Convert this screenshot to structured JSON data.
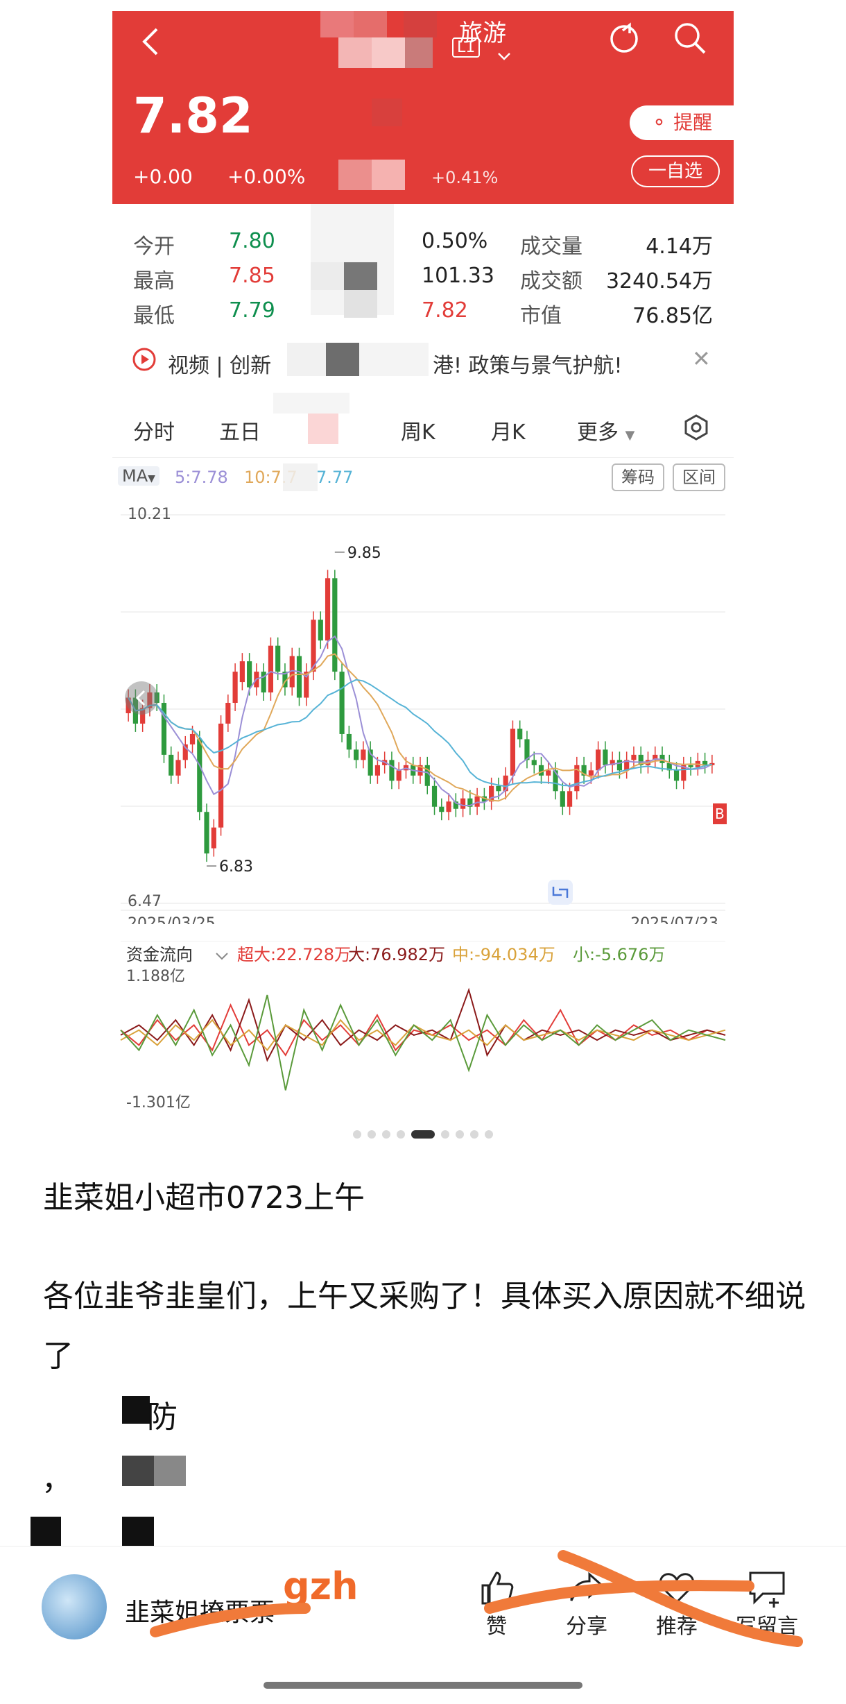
{
  "stock_header": {
    "title": "旅游",
    "market_tag": "L1",
    "price": "7.82",
    "change": "+0.00",
    "change_pct": "+0.00%",
    "extra_pct": "+0.41%",
    "remind_label": "提醒",
    "watchlist_label": "一自选",
    "back_icon": "back-arrow-icon",
    "refresh_icon": "refresh-icon",
    "search_icon": "search-icon"
  },
  "quote": {
    "open_label": "今开",
    "open": "7.80",
    "high_label": "最高",
    "high": "7.85",
    "low_label": "最低",
    "low": "7.79",
    "mid1": "0.50%",
    "mid2": "101.33",
    "mid3": "7.82",
    "volume_label": "成交量",
    "volume": "4.14万",
    "amount_label": "成交额",
    "amount": "3240.54万",
    "mcap_label": "市值",
    "mcap": "76.85亿"
  },
  "banner": {
    "prefix": "视频 | 创新",
    "suffix": "港! 政策与景气护航!"
  },
  "tabs": [
    "分时",
    "五日",
    "周K",
    "月K",
    "更多"
  ],
  "ma_bar": {
    "label": "MA",
    "ma5": "5:7.78",
    "ma10": "10:7.7",
    "ma20": "7.77",
    "chips_label": "筹码",
    "range_label": "区间"
  },
  "chart_data": [
    {
      "type": "candlestick",
      "title": "",
      "ylim": [
        6.47,
        10.21
      ],
      "y_top_label": "10.21",
      "y_bottom_label": "6.47",
      "x_start_label": "2025/03/25",
      "x_end_label": "2025/07/23",
      "max_annotation": "9.85",
      "min_annotation": "6.83",
      "marker_label": "B",
      "candles": [
        {
          "o": 8.3,
          "c": 8.45
        },
        {
          "o": 8.45,
          "c": 8.2
        },
        {
          "o": 8.2,
          "c": 8.35
        },
        {
          "o": 8.35,
          "c": 8.5
        },
        {
          "o": 8.5,
          "c": 8.4
        },
        {
          "o": 8.4,
          "c": 7.9
        },
        {
          "o": 7.9,
          "c": 7.7
        },
        {
          "o": 7.7,
          "c": 7.85
        },
        {
          "o": 7.85,
          "c": 8.0
        },
        {
          "o": 8.0,
          "c": 8.1
        },
        {
          "o": 8.05,
          "c": 7.35
        },
        {
          "o": 7.35,
          "c": 6.95
        },
        {
          "o": 7.0,
          "c": 7.2
        },
        {
          "o": 7.2,
          "c": 8.2
        },
        {
          "o": 8.2,
          "c": 8.4
        },
        {
          "o": 8.4,
          "c": 8.7
        },
        {
          "o": 8.6,
          "c": 8.8
        },
        {
          "o": 8.8,
          "c": 8.55
        },
        {
          "o": 8.55,
          "c": 8.7
        },
        {
          "o": 8.7,
          "c": 8.5
        },
        {
          "o": 8.5,
          "c": 8.95
        },
        {
          "o": 8.95,
          "c": 8.7
        },
        {
          "o": 8.7,
          "c": 8.55
        },
        {
          "o": 8.55,
          "c": 8.85
        },
        {
          "o": 8.85,
          "c": 8.45
        },
        {
          "o": 8.45,
          "c": 8.7
        },
        {
          "o": 8.7,
          "c": 9.2
        },
        {
          "o": 9.2,
          "c": 9.0
        },
        {
          "o": 9.0,
          "c": 9.6
        },
        {
          "o": 9.6,
          "c": 8.7
        },
        {
          "o": 8.7,
          "c": 8.1
        },
        {
          "o": 8.1,
          "c": 7.95
        },
        {
          "o": 7.95,
          "c": 7.85
        },
        {
          "o": 7.85,
          "c": 7.95
        },
        {
          "o": 7.95,
          "c": 7.7
        },
        {
          "o": 7.7,
          "c": 7.8
        },
        {
          "o": 7.8,
          "c": 7.85
        },
        {
          "o": 7.85,
          "c": 7.65
        },
        {
          "o": 7.65,
          "c": 7.75
        },
        {
          "o": 7.75,
          "c": 7.8
        },
        {
          "o": 7.8,
          "c": 7.7
        },
        {
          "o": 7.7,
          "c": 7.8
        },
        {
          "o": 7.8,
          "c": 7.6
        },
        {
          "o": 7.6,
          "c": 7.4
        },
        {
          "o": 7.4,
          "c": 7.35
        },
        {
          "o": 7.35,
          "c": 7.45
        },
        {
          "o": 7.45,
          "c": 7.38
        },
        {
          "o": 7.38,
          "c": 7.48
        },
        {
          "o": 7.48,
          "c": 7.4
        },
        {
          "o": 7.4,
          "c": 7.5
        },
        {
          "o": 7.5,
          "c": 7.45
        },
        {
          "o": 7.45,
          "c": 7.6
        },
        {
          "o": 7.6,
          "c": 7.55
        },
        {
          "o": 7.55,
          "c": 7.7
        },
        {
          "o": 7.7,
          "c": 8.15
        },
        {
          "o": 8.15,
          "c": 8.05
        },
        {
          "o": 8.05,
          "c": 7.85
        },
        {
          "o": 7.85,
          "c": 7.8
        },
        {
          "o": 7.8,
          "c": 7.7
        },
        {
          "o": 7.7,
          "c": 7.75
        },
        {
          "o": 7.75,
          "c": 7.55
        },
        {
          "o": 7.55,
          "c": 7.4
        },
        {
          "o": 7.4,
          "c": 7.55
        },
        {
          "o": 7.55,
          "c": 7.8
        },
        {
          "o": 7.8,
          "c": 7.7
        },
        {
          "o": 7.7,
          "c": 7.75
        },
        {
          "o": 7.75,
          "c": 7.95
        },
        {
          "o": 7.95,
          "c": 7.8
        },
        {
          "o": 7.8,
          "c": 7.85
        },
        {
          "o": 7.85,
          "c": 7.75
        },
        {
          "o": 7.75,
          "c": 7.85
        },
        {
          "o": 7.85,
          "c": 7.9
        },
        {
          "o": 7.9,
          "c": 7.8
        },
        {
          "o": 7.8,
          "c": 7.85
        },
        {
          "o": 7.85,
          "c": 7.9
        },
        {
          "o": 7.9,
          "c": 7.82
        },
        {
          "o": 7.82,
          "c": 7.75
        },
        {
          "o": 7.75,
          "c": 7.65
        },
        {
          "o": 7.65,
          "c": 7.8
        },
        {
          "o": 7.8,
          "c": 7.78
        },
        {
          "o": 7.78,
          "c": 7.84
        },
        {
          "o": 7.84,
          "c": 7.8
        },
        {
          "o": 7.8,
          "c": 7.82
        }
      ]
    },
    {
      "type": "line",
      "title": "资金流向",
      "ylim": [
        -1.301,
        1.188
      ],
      "y_top_label": "1.188亿",
      "y_bottom_label": "-1.301亿",
      "series": [
        {
          "name": "超大:22.728万",
          "color": "#e23c38",
          "values": [
            0.1,
            -0.2,
            0.3,
            -0.1,
            0.2,
            -0.3,
            0.6,
            -0.2,
            0.1,
            -0.4,
            0.3,
            -0.1,
            0.2,
            -0.2,
            0.4,
            -0.3,
            0.1,
            0.0,
            0.2,
            -0.1,
            0.1,
            -0.2,
            0.3,
            -0.1,
            0.5,
            -0.2,
            0.1,
            -0.1,
            0.2,
            0.0,
            0.1,
            -0.1,
            0.1,
            0.0
          ]
        },
        {
          "name": "大:76.982万",
          "color": "#8b1a1a",
          "values": [
            0.0,
            0.2,
            -0.1,
            0.3,
            -0.2,
            0.4,
            -0.3,
            0.7,
            -0.5,
            0.2,
            -0.1,
            0.3,
            -0.2,
            0.1,
            -0.1,
            0.2,
            0.0,
            0.1,
            -0.1,
            0.9,
            -0.4,
            0.2,
            -0.1,
            0.1,
            0.0,
            0.1,
            -0.1,
            0.1,
            0.0,
            0.1,
            -0.1,
            0.0,
            0.1,
            0.0
          ]
        },
        {
          "name": "中:-94.034万",
          "color": "#d9a23a",
          "values": [
            -0.1,
            0.1,
            -0.2,
            0.2,
            -0.1,
            0.3,
            -0.2,
            0.1,
            -0.3,
            0.2,
            0.0,
            -0.2,
            0.3,
            -0.1,
            0.1,
            -0.2,
            0.2,
            0.0,
            -0.1,
            0.1,
            -0.2,
            0.2,
            -0.1,
            0.0,
            0.1,
            -0.1,
            0.1,
            0.0,
            -0.1,
            0.1,
            0.0,
            -0.1,
            0.0,
            0.1
          ]
        },
        {
          "name": "小:-5.676万",
          "color": "#5a9a3a",
          "values": [
            0.1,
            -0.3,
            0.4,
            -0.2,
            0.5,
            -0.4,
            0.2,
            -0.6,
            0.8,
            -1.1,
            0.5,
            -0.3,
            0.6,
            -0.2,
            0.3,
            -0.4,
            0.2,
            -0.1,
            0.3,
            -0.7,
            0.4,
            -0.2,
            0.2,
            -0.1,
            0.1,
            -0.2,
            0.2,
            -0.1,
            0.1,
            0.3,
            -0.1,
            0.1,
            0.0,
            -0.1
          ]
        }
      ]
    }
  ],
  "post": {
    "title": "韭菜姐小超市0723上午",
    "body": "各位韭爷韭皇们，上午又采购了！具体买入原因就不细说了",
    "partial_line": "防",
    "comma": "，"
  },
  "footer": {
    "author": "韭菜姐撩票票",
    "watermark": "gzh",
    "like_label": "赞",
    "share_label": "分享",
    "recommend_label": "推荐",
    "comment_label": "写留言"
  },
  "colors": {
    "header_red": "#e23c38",
    "rise_red": "#e23c38",
    "fall_green": "#0e8f4e",
    "ma5": "#9b8fd6",
    "ma10": "#e0a85a",
    "ma20": "#56b3d6",
    "scribble": "#f07a3a"
  }
}
